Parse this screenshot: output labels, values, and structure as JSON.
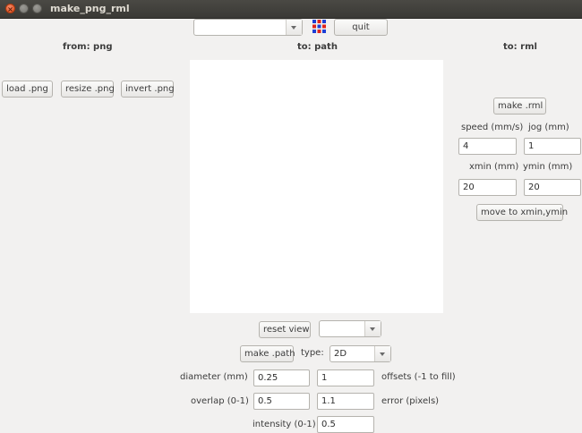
{
  "window": {
    "title": "make_png_rml",
    "close_glyph": "×"
  },
  "toolbar": {
    "quit_label": "quit",
    "top_select_value": ""
  },
  "headers": {
    "from": "from: png",
    "path": "to: path",
    "rml": "to: rml"
  },
  "png": {
    "load_label": "load .png",
    "resize_label": "resize .png",
    "invert_label": "invert .png"
  },
  "rml": {
    "make_label": "make .rml",
    "speed_label": "speed (mm/s)",
    "speed_value": "4",
    "jog_label": "jog (mm)",
    "jog_value": "1",
    "xmin_label": "xmin (mm)",
    "xmin_value": "20",
    "ymin_label": "ymin (mm)",
    "ymin_value": "20",
    "move_label": "move to xmin,ymin"
  },
  "path": {
    "reset_view_label": "reset view",
    "view_select_value": "",
    "make_path_label": "make .path",
    "type_label": "type:",
    "type_value": "2D",
    "diameter_label": "diameter (mm)",
    "diameter_value": "0.25",
    "offsets_value": "1",
    "offsets_label": "offsets (-1 to fill)",
    "overlap_label": "overlap (0-1)",
    "overlap_value": "0.5",
    "error_value": "1.1",
    "error_label": "error (pixels)",
    "intensity_label": "intensity (0-1)",
    "intensity_value": "0.5"
  },
  "colors": {
    "dots_red": "#e0241b",
    "dots_blue": "#1d3fd6",
    "titlebar": "#3c3b37",
    "window_bg": "#f2f1f0"
  }
}
